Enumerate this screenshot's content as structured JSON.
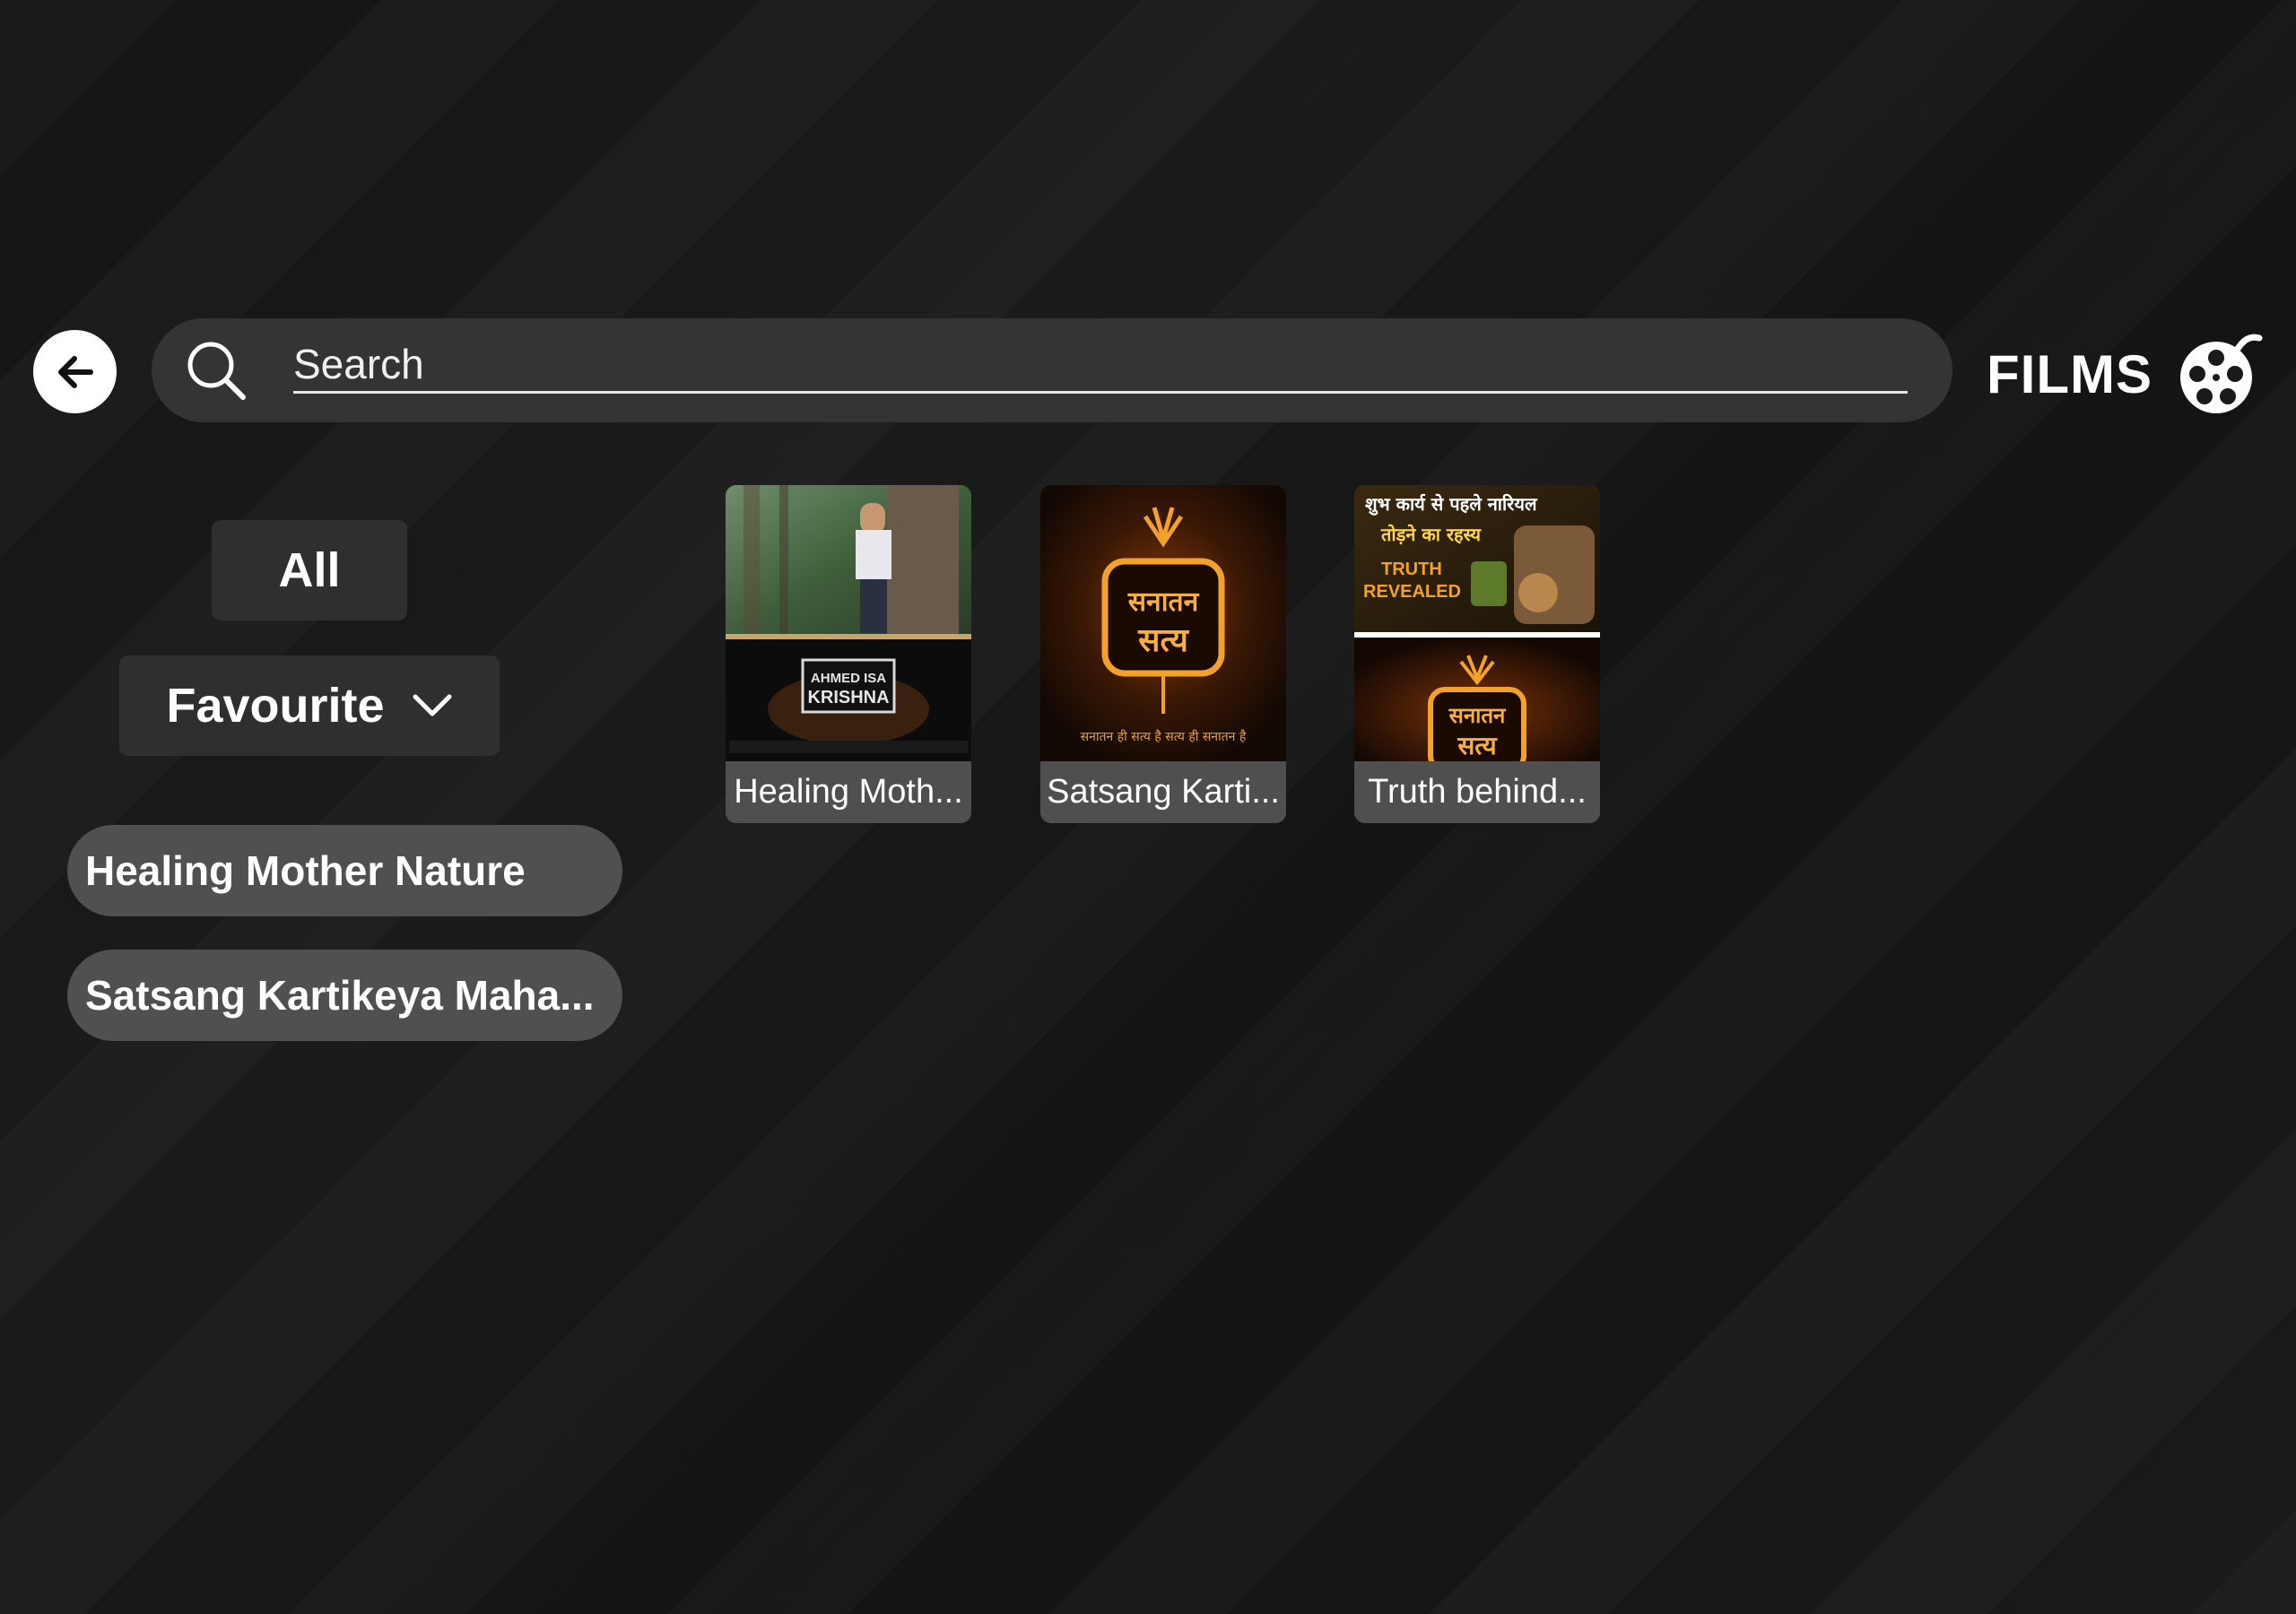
{
  "header": {
    "search_placeholder": "Search",
    "title": "FILMS"
  },
  "filters": {
    "all_label": "All",
    "favourite_label": "Favourite"
  },
  "playlists": [
    {
      "label": "Healing Mother Nature"
    },
    {
      "label": "Satsang Kartikeya Maha..."
    }
  ],
  "videos": [
    {
      "title": "Healing Moth...",
      "thumb_text": "AHMED ISA KRISHNA"
    },
    {
      "title": "Satsang Karti...",
      "thumb_text_main": "सनातन सत्य",
      "thumb_text_sub": "सनातन ही सत्य है सत्य ही सनातन है"
    },
    {
      "title": "Truth behind...",
      "thumb_text_top": "शुभ कार्य से पहले नारियल",
      "thumb_text_top2": "तोड़ने का रहस्य",
      "thumb_text_badge": "TRUTH REVEALED",
      "thumb_text_main": "सनातन सत्य"
    }
  ],
  "colors": {
    "background": "#171717",
    "search_bar": "#343434",
    "chip": "#2f2f2f",
    "playlist_pill": "#505050",
    "accent_gold": "#f2a12a"
  },
  "icons": [
    "back-arrow-icon",
    "search-icon",
    "film-reel-icon",
    "chevron-down-icon"
  ]
}
